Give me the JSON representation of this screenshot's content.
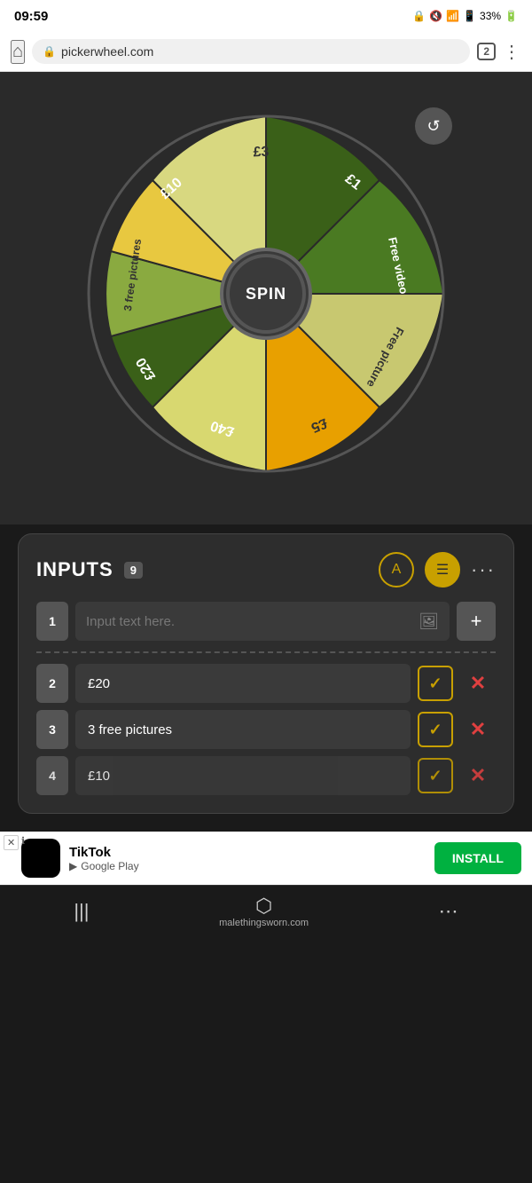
{
  "status_bar": {
    "time": "09:59",
    "battery": "33%"
  },
  "browser": {
    "url": "pickerwheel.com",
    "tab_count": "2"
  },
  "wheel": {
    "spin_label": "SPIN",
    "segments": [
      {
        "label": "£20",
        "color": "#4a7a22",
        "light": false
      },
      {
        "label": "3 free pictures",
        "color": "#c8c870",
        "light": true
      },
      {
        "label": "£10",
        "color": "#e8a000",
        "light": false
      },
      {
        "label": "£3",
        "color": "#d8d870",
        "light": true
      },
      {
        "label": "£1",
        "color": "#3a6018",
        "light": false
      },
      {
        "label": "Free video",
        "color": "#8aaa40",
        "light": true
      },
      {
        "label": "Free picture",
        "color": "#e8c840",
        "light": false
      },
      {
        "label": "£5",
        "color": "#d8d880",
        "light": true
      },
      {
        "label": "£40",
        "color": "#3a6018",
        "light": false
      }
    ]
  },
  "inputs_panel": {
    "title": "INPUTS",
    "count": "9",
    "placeholder": "Input text here.",
    "row1_num": "1",
    "btn_a": "A",
    "rows": [
      {
        "num": "2",
        "value": "£20"
      },
      {
        "num": "3",
        "value": "3 free pictures"
      },
      {
        "num": "4",
        "value": "£10"
      }
    ]
  },
  "ad": {
    "app_name": "TikTok",
    "source": "Google Play",
    "install_label": "INSTALL"
  },
  "bottom_nav": {
    "url": "malethingsworn.com"
  }
}
